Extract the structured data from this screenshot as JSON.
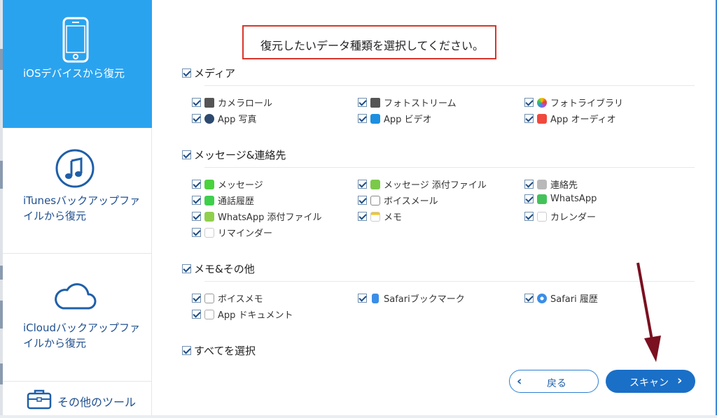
{
  "sidebar": {
    "items": [
      {
        "label": "iOSデバイスから復元",
        "icon": "phone-icon"
      },
      {
        "label_line1": "iTunesバックアップファ",
        "label_line2": "イルから復元",
        "icon": "music-note-icon"
      },
      {
        "label_line1": "iCloudバックアップファ",
        "label_line2": "イルから復元",
        "icon": "cloud-icon"
      }
    ],
    "tools_label": "その他のツール",
    "tools_icon": "toolbox-icon",
    "active_color": "#2aa3ef"
  },
  "main": {
    "instruction": "復元したいデータ種類を選択してください。",
    "sections": [
      {
        "title": "メディア",
        "options": [
          {
            "label": "カメラロール",
            "icon": "camera-icon"
          },
          {
            "label": "フォトストリーム",
            "icon": "camera-icon"
          },
          {
            "label": "フォトライブラリ",
            "icon": "photos-icon"
          },
          {
            "label": "App 写真",
            "icon": "app-photo-icon"
          },
          {
            "label": "App ビデオ",
            "icon": "video-icon"
          },
          {
            "label": "App オーディオ",
            "icon": "music-icon"
          }
        ]
      },
      {
        "title": "メッセージ&連絡先",
        "options": [
          {
            "label": "メッセージ",
            "icon": "message-icon"
          },
          {
            "label": "メッセージ 添付ファイル",
            "icon": "attachment-icon"
          },
          {
            "label": "連絡先",
            "icon": "contacts-icon"
          },
          {
            "label": "通話履歴",
            "icon": "phone-call-icon"
          },
          {
            "label": "ボイスメール",
            "icon": "voicemail-icon"
          },
          {
            "label": "WhatsApp",
            "icon": "whatsapp-icon"
          },
          {
            "label": "WhatsApp 添付ファイル",
            "icon": "whatsapp-attachment-icon"
          },
          {
            "label": "メモ",
            "icon": "notes-icon"
          },
          {
            "label": "カレンダー",
            "icon": "calendar-icon"
          },
          {
            "label": "リマインダー",
            "icon": "reminder-icon"
          }
        ]
      },
      {
        "title": "メモ&その他",
        "options": [
          {
            "label": "ボイスメモ",
            "icon": "voice-memo-icon"
          },
          {
            "label": "Safariブックマーク",
            "icon": "bookmark-icon"
          },
          {
            "label": "Safari 履歴",
            "icon": "safari-icon"
          },
          {
            "label": "App ドキュメント",
            "icon": "document-icon"
          }
        ]
      }
    ],
    "select_all": "すべてを選択"
  },
  "buttons": {
    "back": "戻る",
    "scan": "スキャン"
  },
  "colors": {
    "accent": "#2aa3ef",
    "primary_button": "#1a6fc7",
    "highlight_box": "#d9342b",
    "annotation_arrow": "#7a1020"
  }
}
